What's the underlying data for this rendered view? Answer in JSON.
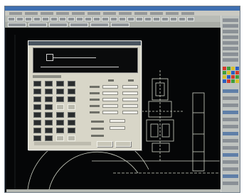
{
  "app": {
    "title_bar": "",
    "menu_count": 12,
    "toolbar_icon_count": 28
  },
  "colors": {
    "canvas_background": "#050607",
    "drawing_lines": "#cfd3c6",
    "dialog_background": "#d8d6c8",
    "palette_swatches": [
      "#d23a2a",
      "#3f9e3a",
      "#d6c02a",
      "#2a5fc2"
    ]
  },
  "dialog": {
    "title": "",
    "grid_rows": 8,
    "grid_columns": 4,
    "field_rows": 5
  },
  "drawing": {
    "description_visible": false
  }
}
